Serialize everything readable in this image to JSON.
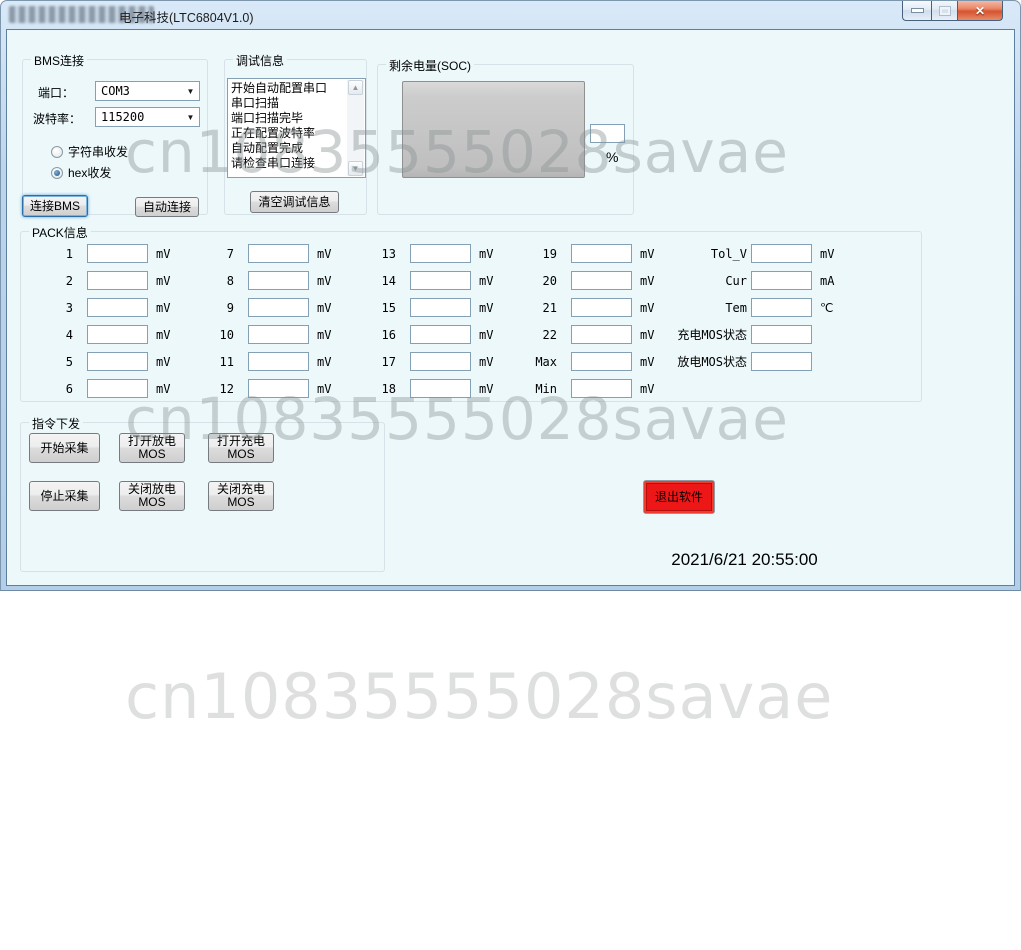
{
  "window": {
    "title": "电子科技(LTC6804V1.0)"
  },
  "icons": {
    "close": "✕",
    "dropdown": "▼",
    "scroll_up": "▲",
    "scroll_down": "▼"
  },
  "bms": {
    "group_label": "BMS连接",
    "port_label": "端口：",
    "port_value": "COM3",
    "baud_label": "波特率：",
    "baud_value": "115200",
    "radio_string_label": "字符串收发",
    "radio_hex_label": "hex收发",
    "connect_button": "连接BMS",
    "auto_connect_button": "自动连接"
  },
  "debug": {
    "group_label": "调试信息",
    "lines": [
      "开始自动配置串口",
      "串口扫描",
      "端口扫描完毕",
      "正在配置波特率",
      "自动配置完成",
      "请检查串口连接"
    ],
    "clear_button": "清空调试信息"
  },
  "soc": {
    "group_label": "剩余电量(SOC)",
    "value": "",
    "percent_label": "%"
  },
  "pack": {
    "group_label": "PACK信息",
    "columns": [
      [
        {
          "label": "1",
          "unit": "mV"
        },
        {
          "label": "2",
          "unit": "mV"
        },
        {
          "label": "3",
          "unit": "mV"
        },
        {
          "label": "4",
          "unit": "mV"
        },
        {
          "label": "5",
          "unit": "mV"
        },
        {
          "label": "6",
          "unit": "mV"
        }
      ],
      [
        {
          "label": "7",
          "unit": "mV"
        },
        {
          "label": "8",
          "unit": "mV"
        },
        {
          "label": "9",
          "unit": "mV"
        },
        {
          "label": "10",
          "unit": "mV"
        },
        {
          "label": "11",
          "unit": "mV"
        },
        {
          "label": "12",
          "unit": "mV"
        }
      ],
      [
        {
          "label": "13",
          "unit": "mV"
        },
        {
          "label": "14",
          "unit": "mV"
        },
        {
          "label": "15",
          "unit": "mV"
        },
        {
          "label": "16",
          "unit": "mV"
        },
        {
          "label": "17",
          "unit": "mV"
        },
        {
          "label": "18",
          "unit": "mV"
        }
      ],
      [
        {
          "label": "19",
          "unit": "mV"
        },
        {
          "label": "20",
          "unit": "mV"
        },
        {
          "label": "21",
          "unit": "mV"
        },
        {
          "label": "22",
          "unit": "mV"
        },
        {
          "label": "Max",
          "unit": "mV"
        },
        {
          "label": "Min",
          "unit": "mV"
        }
      ],
      [
        {
          "label": "Tol_V",
          "unit": "mV"
        },
        {
          "label": "Cur",
          "unit": "mA"
        },
        {
          "label": "Tem",
          "unit": "℃"
        },
        {
          "label": "充电MOS状态",
          "unit": ""
        },
        {
          "label": "放电MOS状态",
          "unit": ""
        }
      ]
    ]
  },
  "commands": {
    "group_label": "指令下发",
    "buttons": [
      "开始采集",
      "打开放电\nMOS",
      "打开充电\nMOS",
      "停止采集",
      "关闭放电\nMOS",
      "关闭充电\nMOS"
    ]
  },
  "exit_button": "退出软件",
  "datetime": "2021/6/21 20:55:00",
  "watermark": "cn10835555028savae",
  "colors": {
    "client_background": "#ecf8fa",
    "titlebar_blue": "#bcd4ec",
    "exit_red": "#ee1717",
    "soc_gray": "#c0c0c0"
  }
}
